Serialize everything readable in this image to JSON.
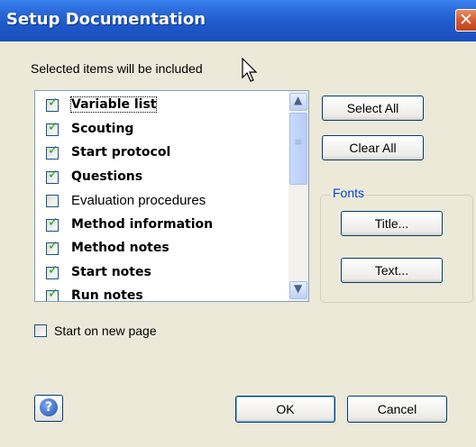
{
  "window": {
    "title": "Setup Documentation",
    "close_glyph": "✕"
  },
  "instruction": "Selected items will be included",
  "list": {
    "items": [
      {
        "label": "Variable list",
        "checked": true,
        "bold": true,
        "focused": true
      },
      {
        "label": "Scouting",
        "checked": true,
        "bold": true
      },
      {
        "label": "Start protocol",
        "checked": true,
        "bold": true
      },
      {
        "label": "Questions",
        "checked": true,
        "bold": true
      },
      {
        "label": "Evaluation procedures",
        "checked": false,
        "bold": false
      },
      {
        "label": "Method information",
        "checked": true,
        "bold": true
      },
      {
        "label": "Method notes",
        "checked": true,
        "bold": true
      },
      {
        "label": "Start notes",
        "checked": true,
        "bold": true
      },
      {
        "label": "Run notes",
        "checked": true,
        "bold": true
      }
    ],
    "check_glyph": "✓"
  },
  "buttons": {
    "select_all": "Select All",
    "clear_all": "Clear All",
    "ok": "OK",
    "cancel": "Cancel"
  },
  "fonts": {
    "group_label": "Fonts",
    "title_button": "Title...",
    "text_button": "Text..."
  },
  "start_new_page": {
    "label": "Start on new page",
    "checked": false
  },
  "icons": {
    "scroll_up": "▲",
    "scroll_down": "▼",
    "thumb_grip": "≡",
    "help": "?"
  }
}
